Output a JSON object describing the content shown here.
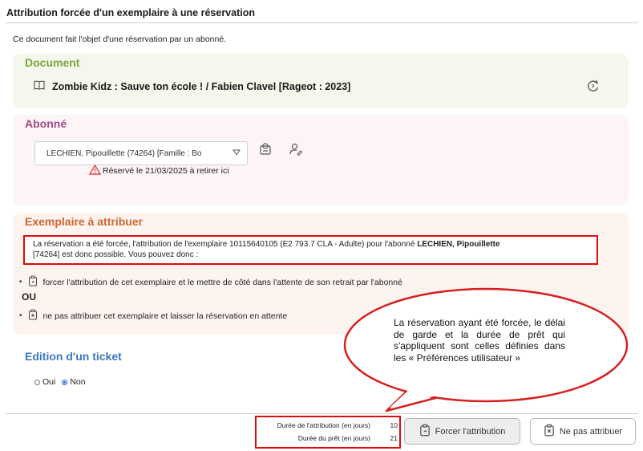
{
  "dialog": {
    "title": "Attribution forcée d'un exemplaire à une réservation",
    "intro": "Ce document fait l'objet d'une réservation par un abonné."
  },
  "document": {
    "heading": "Document",
    "title": "Zombie Kidz : Sauve ton école ! / Fabien Clavel [Rageot : 2023]",
    "icons": [
      "book-icon",
      "refresh-icon"
    ]
  },
  "abonne": {
    "heading": "Abonné",
    "selected": "LECHIEN, Pipouillette (74264) [Famille : Bo",
    "reserved_note": "Réservé le 21/03/2025 à retirer ici",
    "icons": [
      "chevron-down-icon",
      "user-card-icon",
      "user-edit-icon",
      "warning-icon"
    ]
  },
  "exemplaire": {
    "heading": "Exemplaire à attribuer",
    "info_part1": "La réservation a été forcée, l'attribution de l'exemplaire 10115640105 (E2 793.7 CLA - Adulte) pour l'abonné ",
    "info_bold": "LECHIEN, Pipouillette",
    "info_part2": "[74264] est donc possible. Vous pouvez donc :",
    "option1": "forcer l'attribution de cet exemplaire et le mettre de côté dans l'attente de son retrait par l'abonné",
    "ou": "OU",
    "option2": "ne pas attribuer cet exemplaire et laisser la réservation en attente",
    "bullet": "•"
  },
  "ticket": {
    "heading": "Edition d'un ticket",
    "oui": "Oui",
    "non": "Non",
    "selected": "Non"
  },
  "durations": {
    "attribution_label": "Durée de l'attribution (en jours)",
    "attribution_value": "10",
    "pret_label": "Durée du prêt (en jours)",
    "pret_value": "21"
  },
  "buttons": {
    "force": "Forcer l'attribution",
    "ne_pas": "Ne pas attribuer"
  },
  "callout": {
    "text": "La réservation ayant été forcée, le délai de garde et la durée de prêt qui s'appliquent sont celles définies dans les « Préférences utilisateur »"
  },
  "colors": {
    "document_accent": "#7aa63b",
    "abonne_accent": "#a24a86",
    "exemplaire_accent": "#d0652f",
    "ticket_accent": "#3b78c4",
    "highlight_red": "#e10b0b"
  }
}
